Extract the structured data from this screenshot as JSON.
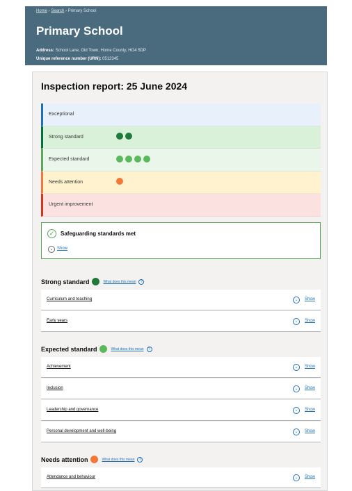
{
  "header": {
    "breadcrumb": [
      "Home",
      "Search",
      "Primary School"
    ],
    "breadcrumb_sep": " › ",
    "school_title": "Primary School",
    "address_label": "Address:",
    "address_value": "School Lane, Old Town, Home County, HO4 5DP",
    "urn_label": "Unique reference number (URN):",
    "urn_value": "0512345"
  },
  "report": {
    "title": "Inspection report: 25 June 2024"
  },
  "scale": [
    {
      "label": "Exceptional",
      "bg": "#e8f1fb",
      "border": "#1d70b8",
      "dots": 0,
      "dot_color": ""
    },
    {
      "label": "Strong standard",
      "bg": "#d9f0d9",
      "border": "#00703c",
      "dots": 2,
      "dot_color": "#1f7a3a"
    },
    {
      "label": "Expected standard",
      "bg": "#eaf6ea",
      "border": "#5aa85a",
      "dots": 4,
      "dot_color": "#5cb85c"
    },
    {
      "label": "Needs attention",
      "bg": "#fff3cf",
      "border": "#f47738",
      "dots": 1,
      "dot_color": "#f47738"
    },
    {
      "label": "Urgent improvement",
      "bg": "#fbe2e0",
      "border": "#d4351c",
      "dots": 0,
      "dot_color": ""
    }
  ],
  "safeguarding": {
    "tick": "✓",
    "label": "Safeguarding standards met",
    "show_icon": "⌄",
    "show": "Show"
  },
  "common": {
    "what_does_this_mean": "What does this mean",
    "help_glyph": "?",
    "show": "Show",
    "show_icon": "⌄"
  },
  "sections": [
    {
      "title": "Strong standard",
      "dot_color": "#1f7a3a",
      "items": [
        "Curriculum and teaching",
        "Early years"
      ]
    },
    {
      "title": "Expected standard",
      "dot_color": "#5cb85c",
      "items": [
        "Achievement",
        "Inclusion",
        "Leadership and governance",
        "Personal development and well-being"
      ]
    },
    {
      "title": "Needs attention",
      "dot_color": "#f47738",
      "items": [
        "Attendance and behaviour"
      ]
    }
  ]
}
